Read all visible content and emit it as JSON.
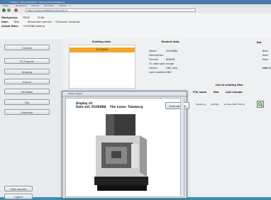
{
  "window": {
    "title": "Infoglue - Dokumentation / Dokumentenverwaltung"
  },
  "menu": [
    "Datei",
    "Bearbeiten",
    "Ansicht",
    "Favoriten",
    "Extras",
    "?"
  ],
  "address": {
    "url": "http://localhost:8080/dms/show/id=4"
  },
  "header_info": {
    "workgroup": {
      "label": "Workgroup:",
      "value": "PDGE",
      "extra_label": "Profil:",
      "extra_value": ""
    },
    "user": {
      "label": "User:",
      "value": "DNC",
      "extra_label": "Transaction partner:",
      "extra_value": "TCServer1 localhost"
    },
    "action": {
      "label": "Actual item:",
      "value": "D1006BA-editing"
    }
  },
  "sidebar": {
    "buttons": [
      "General",
      "TC Program",
      "Drawing",
      "Picture",
      "3D Model",
      "Clip",
      "Simulator"
    ],
    "bottom_buttons": [
      "New request",
      "Logout"
    ]
  },
  "existing": {
    "header": "Existing data",
    "selected": "D1006BA"
  },
  "general": {
    "header": "General data",
    "rows": [
      {
        "k": "Name:",
        "v": "D1006BA"
      },
      {
        "k": "Description:",
        "v": ""
      },
      {
        "k": "Format:",
        "v": "BINARY"
      },
      {
        "k": "TC data type:",
        "v": "Image"
      },
      {
        "k": "Owner:",
        "v": "DNC-strg"
      },
      {
        "k": "Last modifier:",
        "v": "DNC"
      }
    ]
  },
  "right_col": {
    "header": "Bet",
    "items": [
      "Item",
      "Item",
      "Item",
      "List o"
    ]
  },
  "files": {
    "header": "List of existing files",
    "columns": [
      "File name",
      "Size",
      "Last change"
    ],
    "row": {
      "name": "Tubeborg",
      "size": "400798",
      "date": "12-May-2007 09:54"
    }
  },
  "popup": {
    "title": "Media Viewer",
    "display_of": "Display of:",
    "data_set_label": "Data set:",
    "data_set_value": "D1006BA",
    "file_name_label": "File name:",
    "file_name_value": "Tubeborg",
    "close_label": "Close window"
  }
}
